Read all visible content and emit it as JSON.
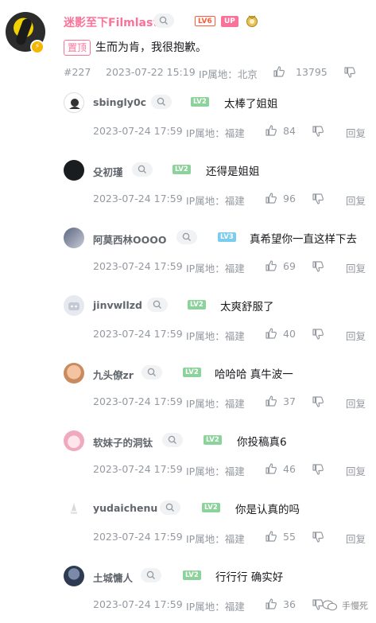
{
  "main": {
    "username": "迷影至下Filmlast",
    "level": "LV6",
    "up_tag": "UP",
    "pin_label": "置顶",
    "text": "生而为肯，我很抱歉。",
    "floor": "#227",
    "timestamp": "2023-07-22 15:19",
    "ip": "IP属地：北京",
    "likes": "13795"
  },
  "labels": {
    "reply": "回复"
  },
  "replies": [
    {
      "username": "sbingly0c",
      "level": "LV2",
      "text": "太棒了姐姐",
      "timestamp": "2023-07-24 17:59",
      "ip": "IP属地：福建",
      "likes": "84"
    },
    {
      "username": "殳初瑾",
      "level": "LV2",
      "text": "还得是姐姐",
      "timestamp": "2023-07-24 17:59",
      "ip": "IP属地：福建",
      "likes": "96"
    },
    {
      "username": "阿莫西林OOOO",
      "level": "LV3",
      "text": "真希望你一直这样下去",
      "timestamp": "2023-07-24 17:59",
      "ip": "IP属地：福建",
      "likes": "69"
    },
    {
      "username": "jinvwllzd",
      "level": "LV2",
      "text": "太爽舒服了",
      "timestamp": "2023-07-24 17:59",
      "ip": "IP属地：福建",
      "likes": "40"
    },
    {
      "username": "九头僚zr",
      "level": "LV2",
      "text": "哈哈哈 真牛波一",
      "timestamp": "2023-07-24 17:59",
      "ip": "IP属地：福建",
      "likes": "37"
    },
    {
      "username": "软妹子的洞钛",
      "level": "LV2",
      "text": "你投稿真6",
      "timestamp": "2023-07-24 17:59",
      "ip": "IP属地：福建",
      "likes": "46"
    },
    {
      "username": "yudaichenu",
      "level": "LV2",
      "text": "你是认真的吗",
      "timestamp": "2023-07-24 17:59",
      "ip": "IP属地：福建",
      "likes": "55"
    },
    {
      "username": "土城慵人",
      "level": "LV2",
      "text": "行行行 确实好",
      "timestamp": "2023-07-24 17:59",
      "ip": "IP属地：福建",
      "likes": "36"
    }
  ],
  "watermark": "手慢死",
  "colors": {
    "accent": "#fb7299",
    "meta": "#9499a0",
    "lv2": "#8bd29b",
    "lv3": "#7bcdef",
    "lv6": "#ff5a3a"
  }
}
